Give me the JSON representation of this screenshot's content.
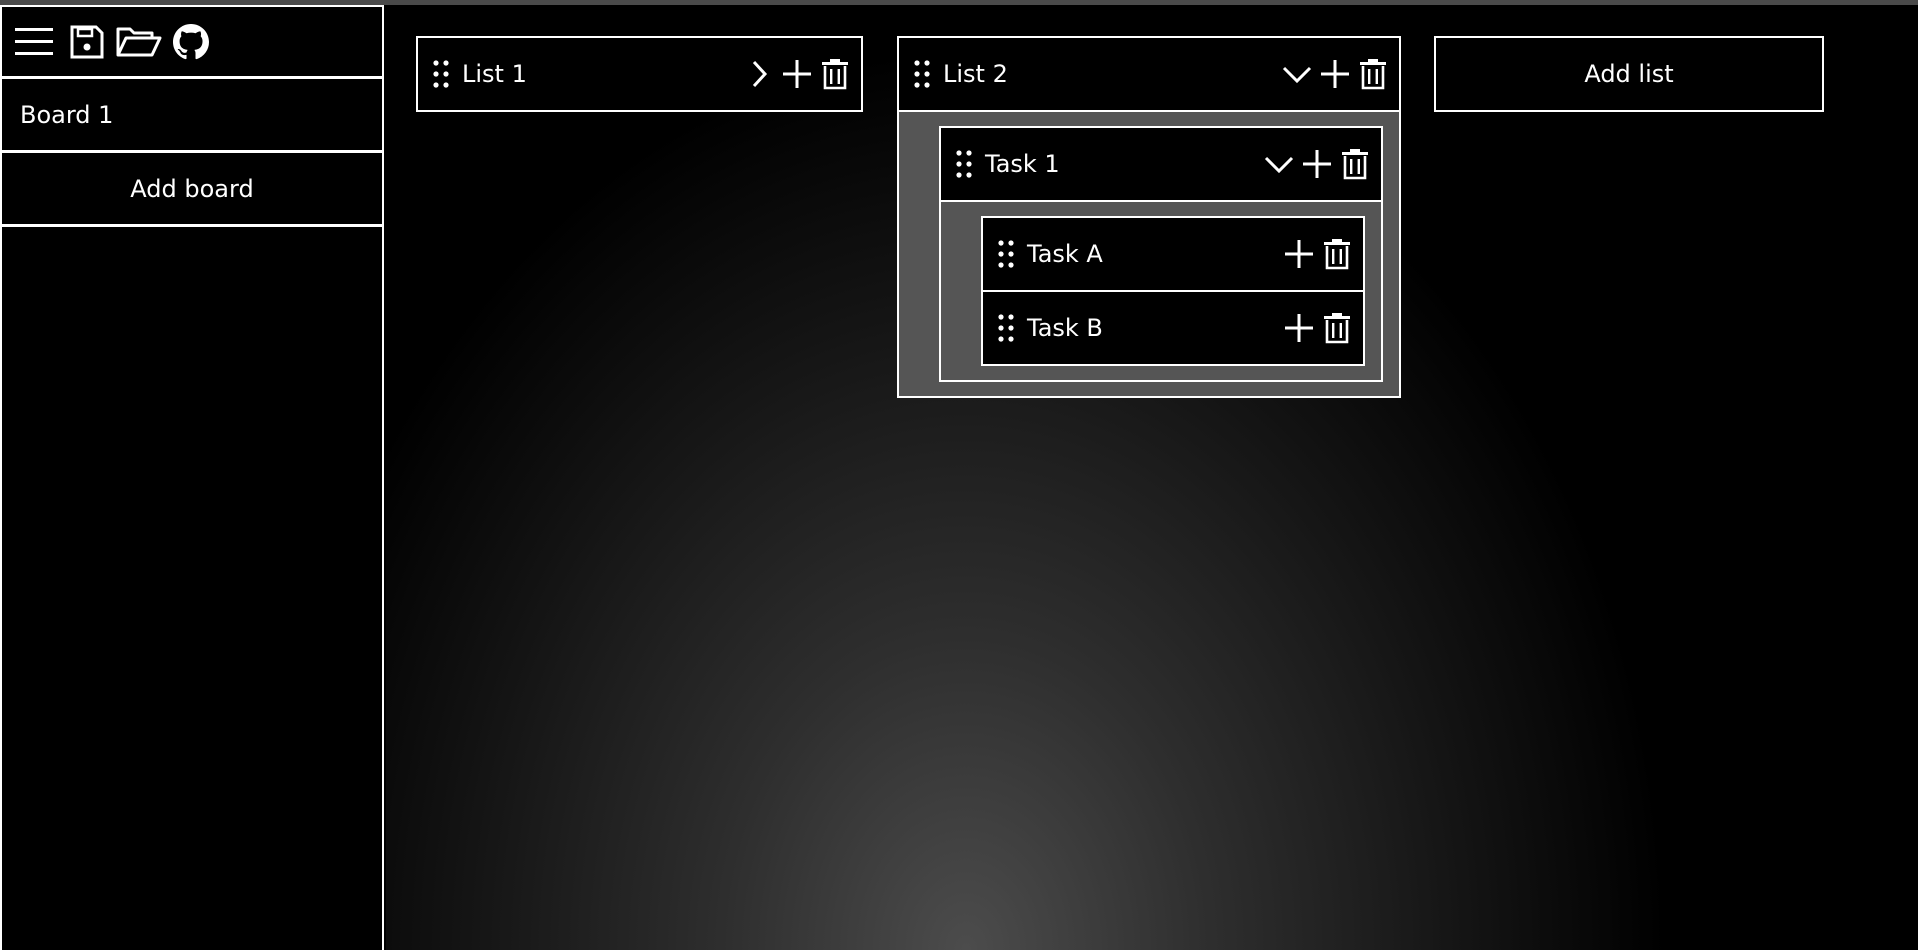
{
  "sidebar": {
    "toolbar": [
      {
        "icon": "menu-icon"
      },
      {
        "icon": "save-icon"
      },
      {
        "icon": "folder-open-icon"
      },
      {
        "icon": "github-icon"
      }
    ],
    "boards": [
      {
        "label": "Board 1"
      }
    ],
    "add_board_label": "Add board"
  },
  "lists": [
    {
      "title": "List 1",
      "expanded": false
    },
    {
      "title": "List 2",
      "expanded": true,
      "tasks": [
        {
          "title": "Task 1",
          "expanded": true,
          "subtasks": [
            {
              "title": "Task A"
            },
            {
              "title": "Task B"
            }
          ]
        }
      ]
    }
  ],
  "add_list_label": "Add list",
  "colors": {
    "background": "#000000",
    "foreground": "#ffffff",
    "nested_bg": "#555555"
  }
}
